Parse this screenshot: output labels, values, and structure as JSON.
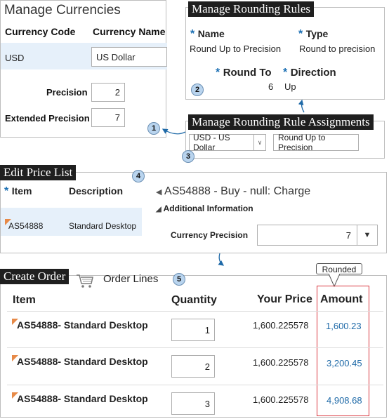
{
  "manage_currencies": {
    "title": "Manage Currencies",
    "col_code": "Currency Code",
    "col_name": "Currency Name",
    "row_code": "USD",
    "row_name": "US Dollar",
    "precision_label": "Precision",
    "precision_value": "2",
    "extended_label": "Extended Precision",
    "extended_value": "7"
  },
  "rounding_rules": {
    "title": "Manage Rounding Rules",
    "star": "*",
    "name_label": "Name",
    "name_value": "Round Up to Precision",
    "type_label": "Type",
    "type_value": "Round to precision",
    "round_to_label": "Round To",
    "round_to_value": "6",
    "direction_label": "Direction",
    "direction_value": "Up"
  },
  "rule_assignments": {
    "title": "Manage Rounding Rule Assignments",
    "currency_select": "USD - US Dollar",
    "rule_value": "Round Up to Precision"
  },
  "price_list": {
    "title": "Edit Price List",
    "item_label": "Item",
    "desc_label": "Description",
    "item_value": "AS54888",
    "desc_value": "Standard Desktop",
    "heading": "AS54888 - Buy - null: Charge",
    "section": "Additional Information",
    "currency_precision_label": "Currency Precision",
    "currency_precision_value": "7"
  },
  "create_order": {
    "title": "Create Order",
    "lines_label": "Order Lines",
    "col_item": "Item",
    "col_quantity": "Quantity",
    "col_price": "Your Price",
    "col_amount": "Amount",
    "rounded_label": "Rounded",
    "rows": [
      {
        "item": "AS54888- Standard Desktop",
        "quantity": "1",
        "price": "1,600.225578",
        "amount": "1,600.23"
      },
      {
        "item": "AS54888- Standard Desktop",
        "quantity": "2",
        "price": "1,600.225578",
        "amount": "3,200.45"
      },
      {
        "item": "AS54888- Standard Desktop",
        "quantity": "3",
        "price": "1,600.225578",
        "amount": "4,908.68"
      }
    ]
  },
  "callouts": [
    "1",
    "2",
    "3",
    "4",
    "5"
  ],
  "icons": {
    "cart": "shopping-cart-icon",
    "dropdown": "chevron-down-icon",
    "expand": "triangle-right-icon",
    "collapse": "triangle-down-icon"
  },
  "colors": {
    "accent_blue": "#1b6fb3",
    "callout_fill": "#b9d4ee",
    "flag_orange": "#e78a48",
    "highlight_red": "#d9363e",
    "row_highlight": "#e6f0fa"
  }
}
